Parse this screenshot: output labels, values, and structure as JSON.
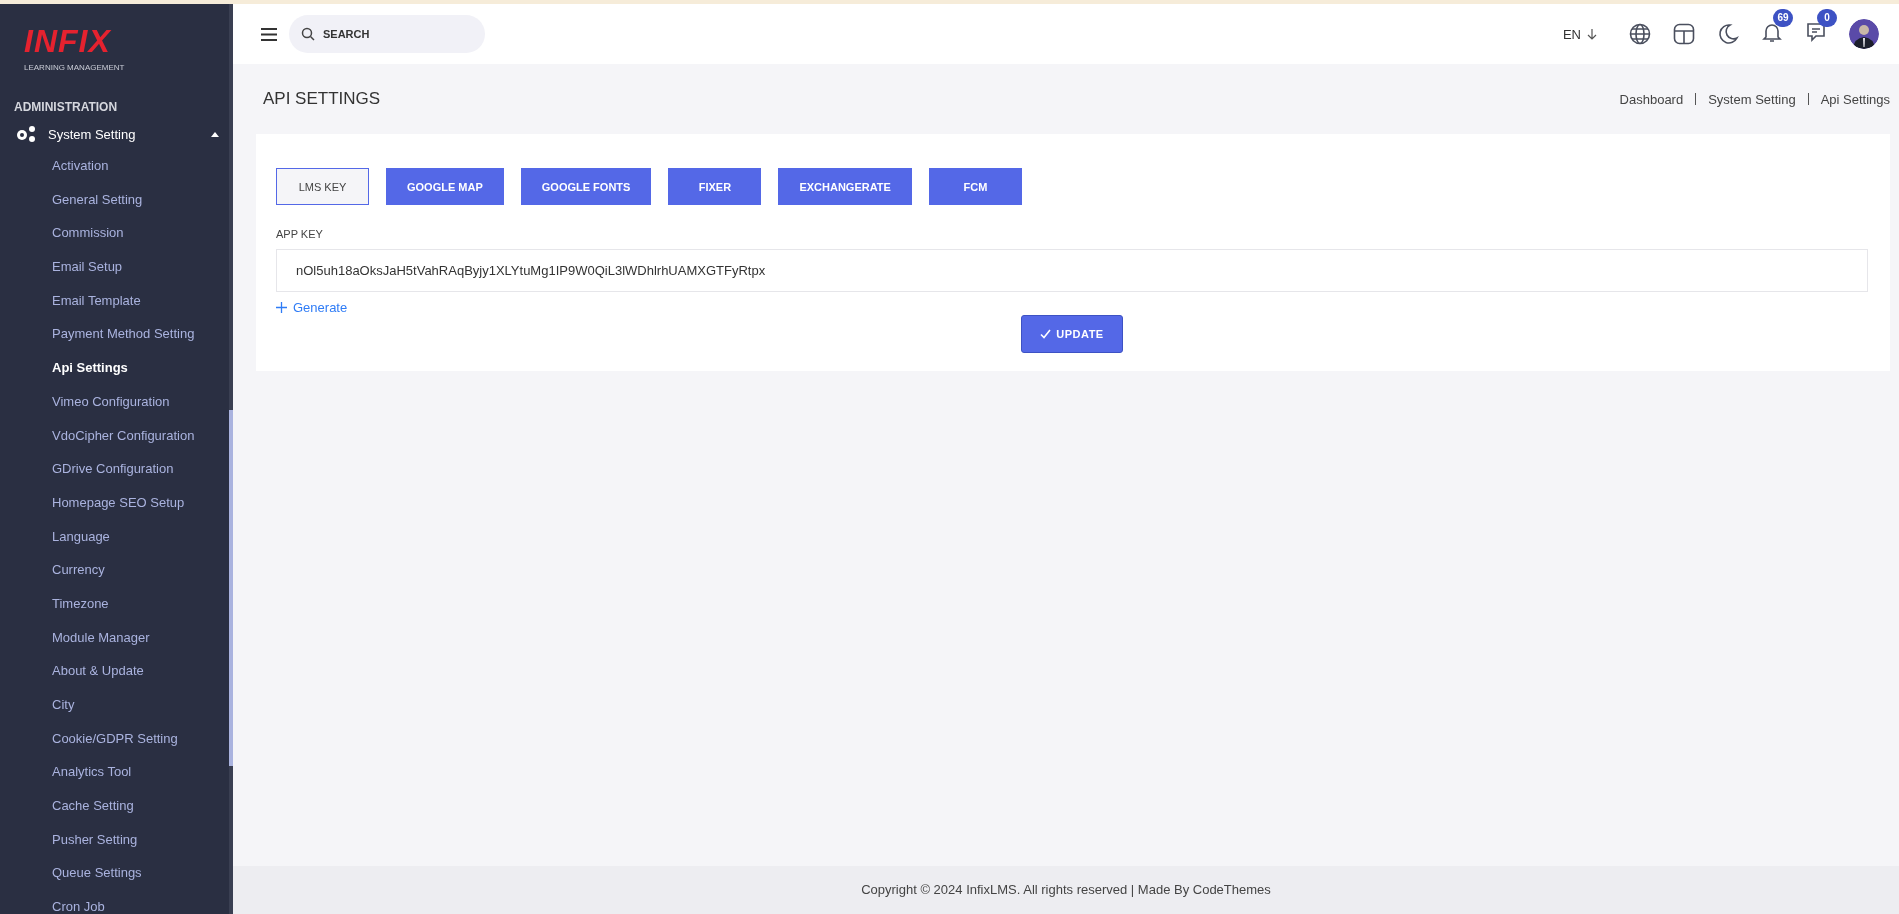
{
  "logo": {
    "wordmark": "INFIX",
    "tagline": "LEARNING MANAGEMENT"
  },
  "sidebar": {
    "section": "ADMINISTRATION",
    "group": {
      "label": "System Setting",
      "expanded": true,
      "items": [
        {
          "label": "Activation",
          "selected": false
        },
        {
          "label": "General Setting",
          "selected": false
        },
        {
          "label": "Commission",
          "selected": false
        },
        {
          "label": "Email Setup",
          "selected": false
        },
        {
          "label": "Email Template",
          "selected": false
        },
        {
          "label": "Payment Method Setting",
          "selected": false
        },
        {
          "label": "Api Settings",
          "selected": true
        },
        {
          "label": "Vimeo Configuration",
          "selected": false
        },
        {
          "label": "VdoCipher Configuration",
          "selected": false
        },
        {
          "label": "GDrive Configuration",
          "selected": false
        },
        {
          "label": "Homepage SEO Setup",
          "selected": false
        },
        {
          "label": "Language",
          "selected": false
        },
        {
          "label": "Currency",
          "selected": false
        },
        {
          "label": "Timezone",
          "selected": false
        },
        {
          "label": "Module Manager",
          "selected": false
        },
        {
          "label": "About & Update",
          "selected": false
        },
        {
          "label": "City",
          "selected": false
        },
        {
          "label": "Cookie/GDPR Setting",
          "selected": false
        },
        {
          "label": "Analytics Tool",
          "selected": false
        },
        {
          "label": "Cache Setting",
          "selected": false
        },
        {
          "label": "Pusher Setting",
          "selected": false
        },
        {
          "label": "Queue Settings",
          "selected": false
        },
        {
          "label": "Cron Job",
          "selected": false
        }
      ]
    }
  },
  "topbar": {
    "search": {
      "placeholder": "SEARCH"
    },
    "language": "EN",
    "notifications": "69",
    "messages": "0"
  },
  "page": {
    "title": "API SETTINGS",
    "breadcrumb": [
      "Dashboard",
      "System Setting",
      "Api Settings"
    ]
  },
  "tabs": [
    {
      "label": "LMS KEY",
      "selected": true
    },
    {
      "label": "GOOGLE MAP",
      "selected": false
    },
    {
      "label": "GOOGLE FONTS",
      "selected": false
    },
    {
      "label": "FIXER",
      "selected": false
    },
    {
      "label": "EXCHANGERATE",
      "selected": false
    },
    {
      "label": "FCM",
      "selected": false
    }
  ],
  "form": {
    "label": "APP KEY",
    "value": "nOl5uh18aOksJaH5tVahRAqByjy1XLYtuMg1IP9W0QiL3lWDhlrhUAMXGTFyRtpx",
    "generate": "Generate",
    "submit": "UPDATE"
  },
  "footer": "Copyright © 2024 InfixLMS. All rights reserved | Made By CodeThemes"
}
